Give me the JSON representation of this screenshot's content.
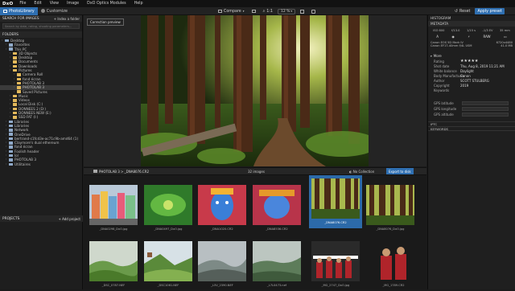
{
  "app": {
    "logo": "DxO",
    "menu": [
      "File",
      "Edit",
      "View",
      "Image",
      "DxO Optics Modules",
      "Help"
    ]
  },
  "tabs": {
    "library": "PhotoLibrary",
    "customize": "Customize"
  },
  "toolbar": {
    "compare": "Compare",
    "zoom": "1:1",
    "zoom_pct": "12 %",
    "reset": "Reset",
    "apply_preset": "Apply preset"
  },
  "left": {
    "search_header": "Search for images",
    "index_folder": "Index a folder",
    "search_placeholder": "Search by date, rating, shooting parameters...",
    "folders_header": "Folders",
    "tree": [
      {
        "label": "Desktop",
        "indent": 0
      },
      {
        "label": "Favorites",
        "indent": 1
      },
      {
        "label": "This PC",
        "indent": 1
      },
      {
        "label": "3D Objects",
        "indent": 2
      },
      {
        "label": "Desktop",
        "indent": 2
      },
      {
        "label": "Documents",
        "indent": 2
      },
      {
        "label": "Downloads",
        "indent": 2
      },
      {
        "label": "Pictures",
        "indent": 2
      },
      {
        "label": "Camera Roll",
        "indent": 3
      },
      {
        "label": "fond écran",
        "indent": 3
      },
      {
        "label": "PHOTOLAB 3",
        "indent": 3
      },
      {
        "label": "PHOTOLAB 3",
        "indent": 3,
        "selected": true
      },
      {
        "label": "Saved Pictures",
        "indent": 3
      },
      {
        "label": "Music",
        "indent": 2
      },
      {
        "label": "Videos",
        "indent": 2
      },
      {
        "label": "Local Disk (C:)",
        "indent": 2
      },
      {
        "label": "DONNEES 2 (D:)",
        "indent": 2
      },
      {
        "label": "DONNEES NEW (E:)",
        "indent": 2
      },
      {
        "label": "SSD FAT (I:)",
        "indent": 2
      },
      {
        "label": "Libraries",
        "indent": 1
      },
      {
        "label": "Libraries",
        "indent": 1
      },
      {
        "label": "Network",
        "indent": 1
      },
      {
        "label": "OneDrive",
        "indent": 1
      },
      {
        "label": "bertrand-c1fcd3e-ac71c9b-amd64 (1)",
        "indent": 1
      },
      {
        "label": "Claymore's dual ethereum",
        "indent": 1
      },
      {
        "label": "fond écran",
        "indent": 1
      },
      {
        "label": "Foolish header",
        "indent": 1
      },
      {
        "label": "lol",
        "indent": 1
      },
      {
        "label": "PHOTOLAB 3",
        "indent": 1
      },
      {
        "label": "Utilitaires",
        "indent": 1
      }
    ],
    "projects_header": "Projects",
    "add_project": "+ Add project"
  },
  "viewer": {
    "correction_preview": "Correction preview"
  },
  "browser": {
    "path": "PHOTOLAB 3 > _DNA8076.CR2",
    "count": "32 images",
    "no_collection": "No Collection",
    "export": "Export to disk",
    "thumbs": [
      {
        "name": "_DNA0298_DxO.jpg",
        "kind": "buildings"
      },
      {
        "name": "_DNA0497_DxO.jpg",
        "kind": "green"
      },
      {
        "name": "_DNA1020.CR2",
        "kind": "blue_face"
      },
      {
        "name": "_DNA8536.CR2",
        "kind": "blue_face2"
      },
      {
        "name": "_DNA8076.CR2",
        "kind": "forest",
        "selected": true
      },
      {
        "name": "_DNA8076_DxO.jpg",
        "kind": "forest"
      },
      {
        "name": "_DSC_0787.NEF",
        "kind": "hills"
      },
      {
        "name": "_DSC1061.NEF",
        "kind": "hills2"
      },
      {
        "name": "_L5V_2390.NEF",
        "kind": "mist"
      },
      {
        "name": "_L7L0473.nef",
        "kind": "mist2"
      },
      {
        "name": "_MG_2747_DxO.jpg",
        "kind": "monks"
      },
      {
        "name": "_MG_1789.CR2",
        "kind": "monks2"
      }
    ]
  },
  "right": {
    "histogram": "Histogram",
    "metadata": "Metadata",
    "exif": [
      "ISO 800",
      "f/13.0",
      "1/15 s",
      "-1/3 EV",
      "35 mm"
    ],
    "format": "RAW",
    "camera": "Canon EOS 5D Mark IV",
    "dims": "6720x4480",
    "lens": "Canon EF17-40mm f/4L USM",
    "size": "41.0 MB",
    "more": "More",
    "fields": [
      {
        "k": "Rating",
        "v": "★★★★★"
      },
      {
        "k": "Shot date",
        "v": "Thu, Aug 8, 2019 11:21 AM"
      },
      {
        "k": "White balance",
        "v": "Daylight"
      },
      {
        "k": "Body Manufacturer",
        "v": "Canon"
      },
      {
        "k": "Author",
        "v": "SCOTT STULBERG"
      },
      {
        "k": "Copyright",
        "v": "2019"
      },
      {
        "k": "Keywords",
        "v": ""
      }
    ],
    "gps": [
      "GPS latitude",
      "GPS longitude",
      "GPS altitude"
    ],
    "iptc": "IPTC",
    "keywords": "KEYWORDS"
  }
}
